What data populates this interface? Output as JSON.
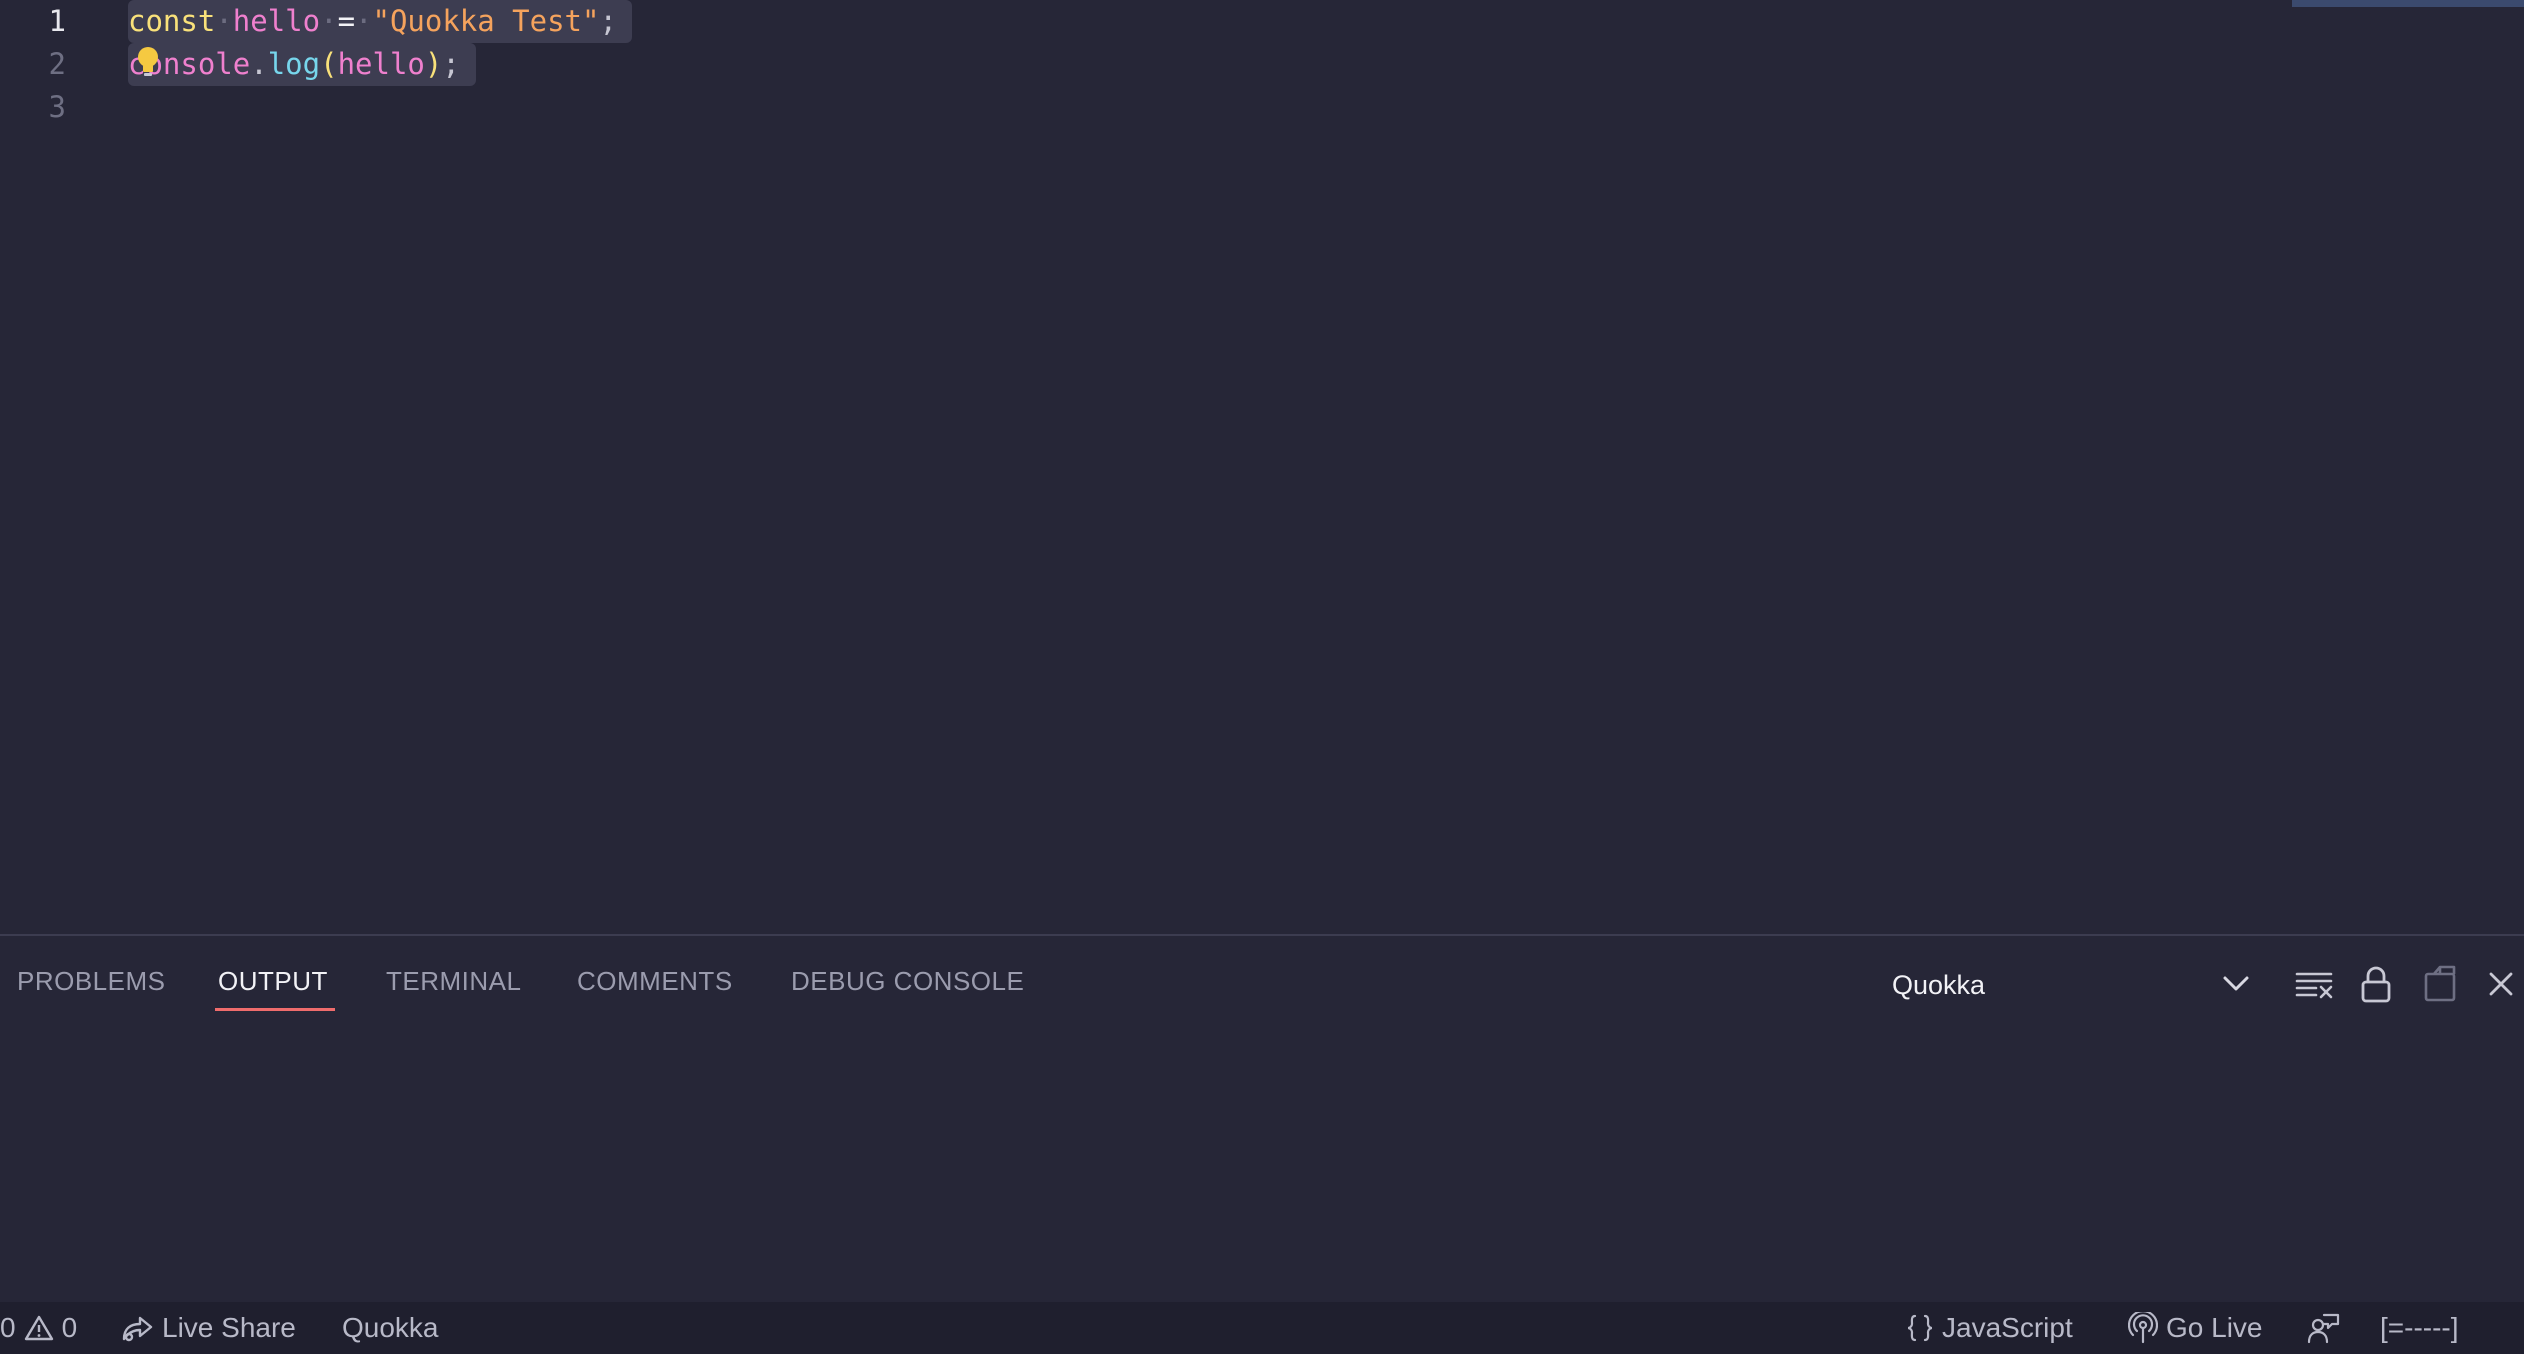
{
  "editor": {
    "line_numbers": [
      "1",
      "2",
      "3"
    ],
    "code": {
      "line1": {
        "keyword": "const",
        "variable": "hello",
        "operator": "=",
        "string": "\"Quokka Test\"",
        "semicolon": ";"
      },
      "line2": {
        "first_char": "c",
        "object_rest": "onsole",
        "dot": ".",
        "method": "log",
        "open_paren": "(",
        "argument": "hello",
        "close_paren": ")",
        "semicolon": ";"
      }
    },
    "whitespace_glyph": "·",
    "icons": {
      "code_action": "lightbulb-icon"
    }
  },
  "panel": {
    "tabs": [
      {
        "label": "PROBLEMS",
        "active": false
      },
      {
        "label": "OUTPUT",
        "active": true
      },
      {
        "label": "TERMINAL",
        "active": false
      },
      {
        "label": "COMMENTS",
        "active": false
      },
      {
        "label": "DEBUG CONSOLE",
        "active": false
      }
    ],
    "output_channel": "Quokka",
    "actions": [
      "clear-output-icon",
      "lock-scroll-icon",
      "open-in-editor-icon",
      "close-icon"
    ]
  },
  "statusbar": {
    "errors": "0",
    "warnings": "0",
    "live_share": "Live Share",
    "quokka": "Quokka",
    "language": "JavaScript",
    "go_live": "Go Live",
    "progress": "[=-----]"
  },
  "colors": {
    "editor_bg": "#262637",
    "status_bg": "#1f1f2e",
    "keyword": "#f9e17a",
    "variable": "#ef80ce",
    "string": "#f5a35d",
    "function": "#77d6ec",
    "active_tab_underline": "#ef6c6c"
  }
}
